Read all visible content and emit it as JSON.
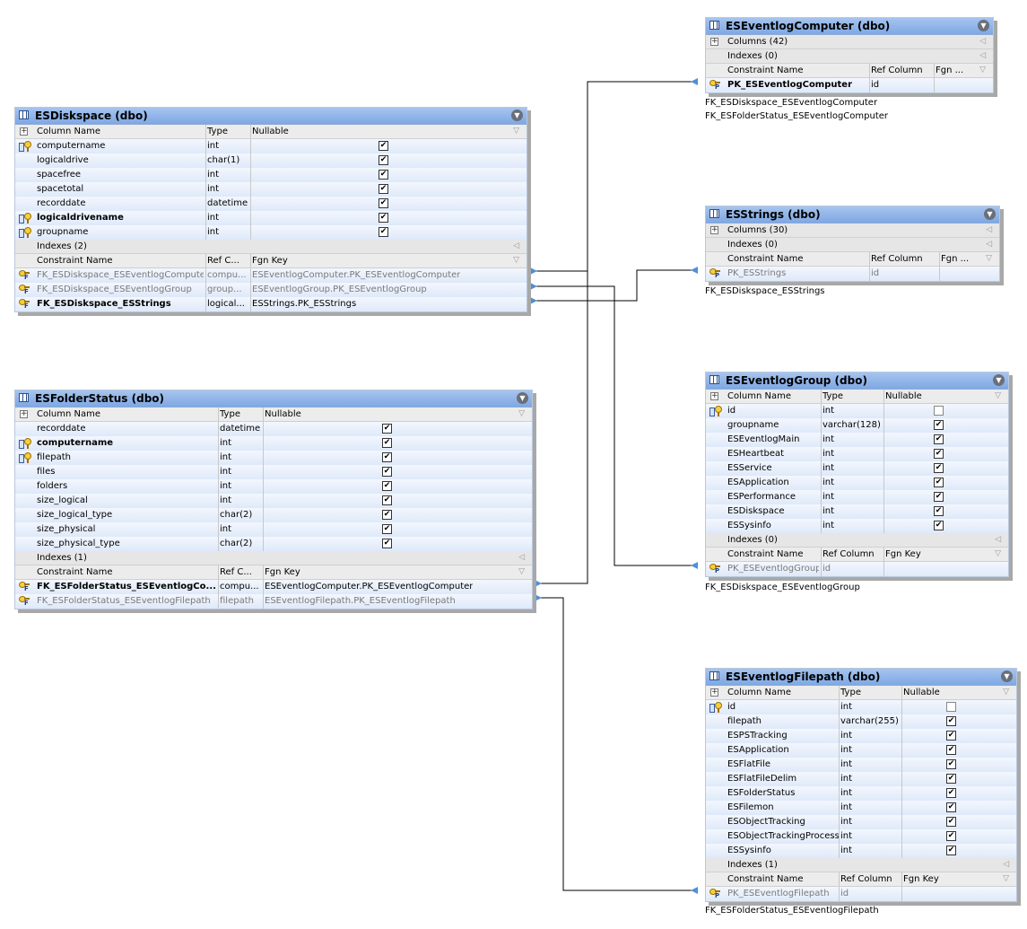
{
  "tables": {
    "diskspace": {
      "title": "ESDiskspace (dbo)",
      "col_headers": [
        "Column Name",
        "Type",
        "Nullable"
      ],
      "columns": [
        {
          "name": "computername",
          "type": "int",
          "nullable": true,
          "key": true,
          "bold": false
        },
        {
          "name": "logicaldrive",
          "type": "char(1)",
          "nullable": true,
          "key": false,
          "bold": false
        },
        {
          "name": "spacefree",
          "type": "int",
          "nullable": true,
          "key": false,
          "bold": false
        },
        {
          "name": "spacetotal",
          "type": "int",
          "nullable": true,
          "key": false,
          "bold": false
        },
        {
          "name": "recorddate",
          "type": "datetime",
          "nullable": true,
          "key": false,
          "bold": false
        },
        {
          "name": "logicaldrivename",
          "type": "int",
          "nullable": true,
          "key": true,
          "bold": true
        },
        {
          "name": "groupname",
          "type": "int",
          "nullable": true,
          "key": true,
          "bold": false
        }
      ],
      "indexes": "Indexes (2)",
      "constraint_headers": [
        "Constraint Name",
        "Ref C...",
        "Fgn Key"
      ],
      "constraints": [
        {
          "name": "FK_ESDiskspace_ESEventlogComputer",
          "ref": "compu...",
          "fgn": "ESEventlogComputer.PK_ESEventlogComputer",
          "bold": false
        },
        {
          "name": "FK_ESDiskspace_ESEventlogGroup",
          "ref": "group...",
          "fgn": "ESEventlogGroup.PK_ESEventlogGroup",
          "bold": false
        },
        {
          "name": "FK_ESDiskspace_ESStrings",
          "ref": "logical...",
          "fgn": "ESStrings.PK_ESStrings",
          "bold": true
        }
      ]
    },
    "folderstatus": {
      "title": "ESFolderStatus (dbo)",
      "col_headers": [
        "Column Name",
        "Type",
        "Nullable"
      ],
      "columns": [
        {
          "name": "recorddate",
          "type": "datetime",
          "nullable": true,
          "key": false,
          "bold": false
        },
        {
          "name": "computername",
          "type": "int",
          "nullable": true,
          "key": true,
          "bold": true
        },
        {
          "name": "filepath",
          "type": "int",
          "nullable": true,
          "key": true,
          "bold": false
        },
        {
          "name": "files",
          "type": "int",
          "nullable": true,
          "key": false,
          "bold": false
        },
        {
          "name": "folders",
          "type": "int",
          "nullable": true,
          "key": false,
          "bold": false
        },
        {
          "name": "size_logical",
          "type": "int",
          "nullable": true,
          "key": false,
          "bold": false
        },
        {
          "name": "size_logical_type",
          "type": "char(2)",
          "nullable": true,
          "key": false,
          "bold": false
        },
        {
          "name": "size_physical",
          "type": "int",
          "nullable": true,
          "key": false,
          "bold": false
        },
        {
          "name": "size_physical_type",
          "type": "char(2)",
          "nullable": true,
          "key": false,
          "bold": false
        }
      ],
      "indexes": "Indexes (1)",
      "constraint_headers": [
        "Constraint Name",
        "Ref C...",
        "Fgn Key"
      ],
      "constraints": [
        {
          "name": "FK_ESFolderStatus_ESEventlogCo...",
          "ref": "compu...",
          "fgn": "ESEventlogComputer.PK_ESEventlogComputer",
          "bold": true
        },
        {
          "name": "FK_ESFolderStatus_ESEventlogFilepath",
          "ref": "filepath",
          "fgn": "ESEventlogFilepath.PK_ESEventlogFilepath",
          "bold": false
        }
      ]
    },
    "computer": {
      "title": "ESEventlogComputer (dbo)",
      "columns_label": "Columns (42)",
      "indexes": "Indexes (0)",
      "constraint_headers": [
        "Constraint Name",
        "Ref Column",
        "Fgn ..."
      ],
      "constraints": [
        {
          "name": "PK_ESEventlogComputer",
          "ref": "id",
          "fgn": "",
          "bold": true
        }
      ],
      "fk_labels": [
        "FK_ESDiskspace_ESEventlogComputer",
        "FK_ESFolderStatus_ESEventlogComputer"
      ]
    },
    "strings": {
      "title": "ESStrings (dbo)",
      "columns_label": "Columns (30)",
      "indexes": "Indexes (0)",
      "constraint_headers": [
        "Constraint Name",
        "Ref Column",
        "Fgn ..."
      ],
      "constraints": [
        {
          "name": "PK_ESStrings",
          "ref": "id",
          "fgn": "",
          "bold": false
        }
      ],
      "fk_labels": [
        "FK_ESDiskspace_ESStrings"
      ]
    },
    "group": {
      "title": "ESEventlogGroup (dbo)",
      "col_headers": [
        "Column Name",
        "Type",
        "Nullable"
      ],
      "columns": [
        {
          "name": "id",
          "type": "int",
          "nullable": false,
          "key": true,
          "bold": false
        },
        {
          "name": "groupname",
          "type": "varchar(128)",
          "nullable": true,
          "key": false,
          "bold": false
        },
        {
          "name": "ESEventlogMain",
          "type": "int",
          "nullable": true,
          "key": false,
          "bold": false
        },
        {
          "name": "ESHeartbeat",
          "type": "int",
          "nullable": true,
          "key": false,
          "bold": false
        },
        {
          "name": "ESService",
          "type": "int",
          "nullable": true,
          "key": false,
          "bold": false
        },
        {
          "name": "ESApplication",
          "type": "int",
          "nullable": true,
          "key": false,
          "bold": false
        },
        {
          "name": "ESPerformance",
          "type": "int",
          "nullable": true,
          "key": false,
          "bold": false
        },
        {
          "name": "ESDiskspace",
          "type": "int",
          "nullable": true,
          "key": false,
          "bold": false
        },
        {
          "name": "ESSysinfo",
          "type": "int",
          "nullable": true,
          "key": false,
          "bold": false
        }
      ],
      "indexes": "Indexes (0)",
      "constraint_headers": [
        "Constraint Name",
        "Ref Column",
        "Fgn Key"
      ],
      "constraints": [
        {
          "name": "PK_ESEventlogGroup",
          "ref": "id",
          "fgn": "",
          "bold": false
        }
      ],
      "fk_labels": [
        "FK_ESDiskspace_ESEventlogGroup"
      ]
    },
    "filepath": {
      "title": "ESEventlogFilepath (dbo)",
      "col_headers": [
        "Column Name",
        "Type",
        "Nullable"
      ],
      "columns": [
        {
          "name": "id",
          "type": "int",
          "nullable": false,
          "key": true,
          "bold": false
        },
        {
          "name": "filepath",
          "type": "varchar(255)",
          "nullable": true,
          "key": false,
          "bold": false
        },
        {
          "name": "ESPSTracking",
          "type": "int",
          "nullable": true,
          "key": false,
          "bold": false
        },
        {
          "name": "ESApplication",
          "type": "int",
          "nullable": true,
          "key": false,
          "bold": false
        },
        {
          "name": "ESFlatFile",
          "type": "int",
          "nullable": true,
          "key": false,
          "bold": false
        },
        {
          "name": "ESFlatFileDelim",
          "type": "int",
          "nullable": true,
          "key": false,
          "bold": false
        },
        {
          "name": "ESFolderStatus",
          "type": "int",
          "nullable": true,
          "key": false,
          "bold": false
        },
        {
          "name": "ESFilemon",
          "type": "int",
          "nullable": true,
          "key": false,
          "bold": false
        },
        {
          "name": "ESObjectTracking",
          "type": "int",
          "nullable": true,
          "key": false,
          "bold": false
        },
        {
          "name": "ESObjectTrackingProcess",
          "type": "int",
          "nullable": true,
          "key": false,
          "bold": false
        },
        {
          "name": "ESSysinfo",
          "type": "int",
          "nullable": true,
          "key": false,
          "bold": false
        }
      ],
      "indexes": "Indexes (1)",
      "constraint_headers": [
        "Constraint Name",
        "Ref Column",
        "Fgn Key"
      ],
      "constraints": [
        {
          "name": "PK_ESEventlogFilepath",
          "ref": "id",
          "fgn": "",
          "bold": false
        }
      ],
      "fk_labels": [
        "FK_ESFolderStatus_ESEventlogFilepath"
      ]
    }
  }
}
